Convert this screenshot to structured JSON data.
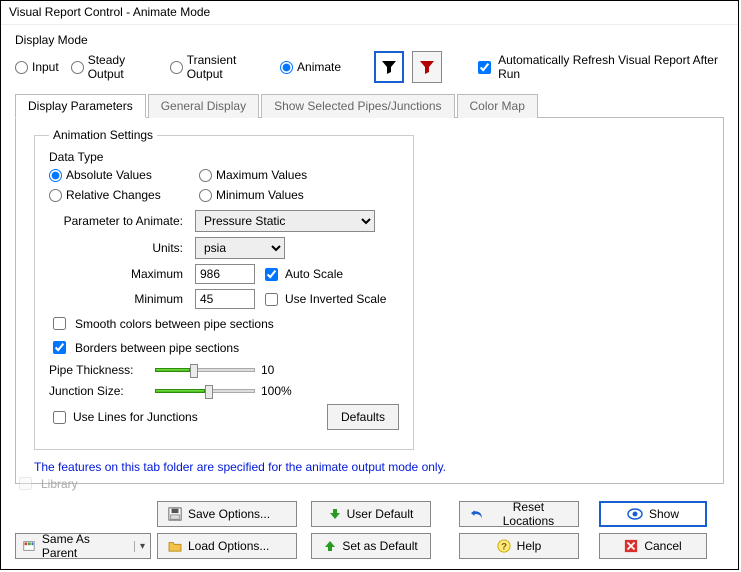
{
  "title": "Visual Report Control - Animate Mode",
  "displayMode": {
    "label": "Display Mode",
    "options": {
      "input": "Input",
      "steady": "Steady Output",
      "transient": "Transient Output",
      "animate": "Animate"
    },
    "autoRefresh": "Automatically Refresh Visual Report After Run"
  },
  "tabs": {
    "displayParameters": "Display Parameters",
    "generalDisplay": "General Display",
    "showSelected": "Show Selected Pipes/Junctions",
    "colorMap": "Color Map"
  },
  "animation": {
    "legend": "Animation Settings",
    "dataTypeLabel": "Data Type",
    "dataTypeOptions": {
      "absolute": "Absolute Values",
      "maximum": "Maximum Values",
      "relative": "Relative Changes",
      "minimum": "Minimum Values"
    },
    "paramLabel": "Parameter to Animate:",
    "paramValue": "Pressure Static",
    "unitsLabel": "Units:",
    "unitsValue": "psia",
    "maxLabel": "Maximum",
    "maxValue": "986",
    "minLabel": "Minimum",
    "minValue": "45",
    "autoScale": "Auto Scale",
    "invertedScale": "Use Inverted Scale",
    "smoothColors": "Smooth colors between pipe sections",
    "bordersBetween": "Borders between pipe sections",
    "pipeThicknessLabel": "Pipe Thickness:",
    "pipeThicknessValue": "10",
    "junctionSizeLabel": "Junction Size:",
    "junctionSizeValue": "100%",
    "useLines": "Use Lines for Junctions",
    "defaults": "Defaults"
  },
  "note": "The features on this tab folder are specified for the animate output mode only.",
  "bottom": {
    "library": "Library",
    "sameAsParent": "Same As Parent",
    "saveOptions": "Save Options...",
    "loadOptions": "Load Options...",
    "userDefault": "User Default",
    "setAsDefault": "Set as Default",
    "resetLocations": "Reset Locations",
    "help": "Help",
    "show": "Show",
    "cancel": "Cancel"
  }
}
